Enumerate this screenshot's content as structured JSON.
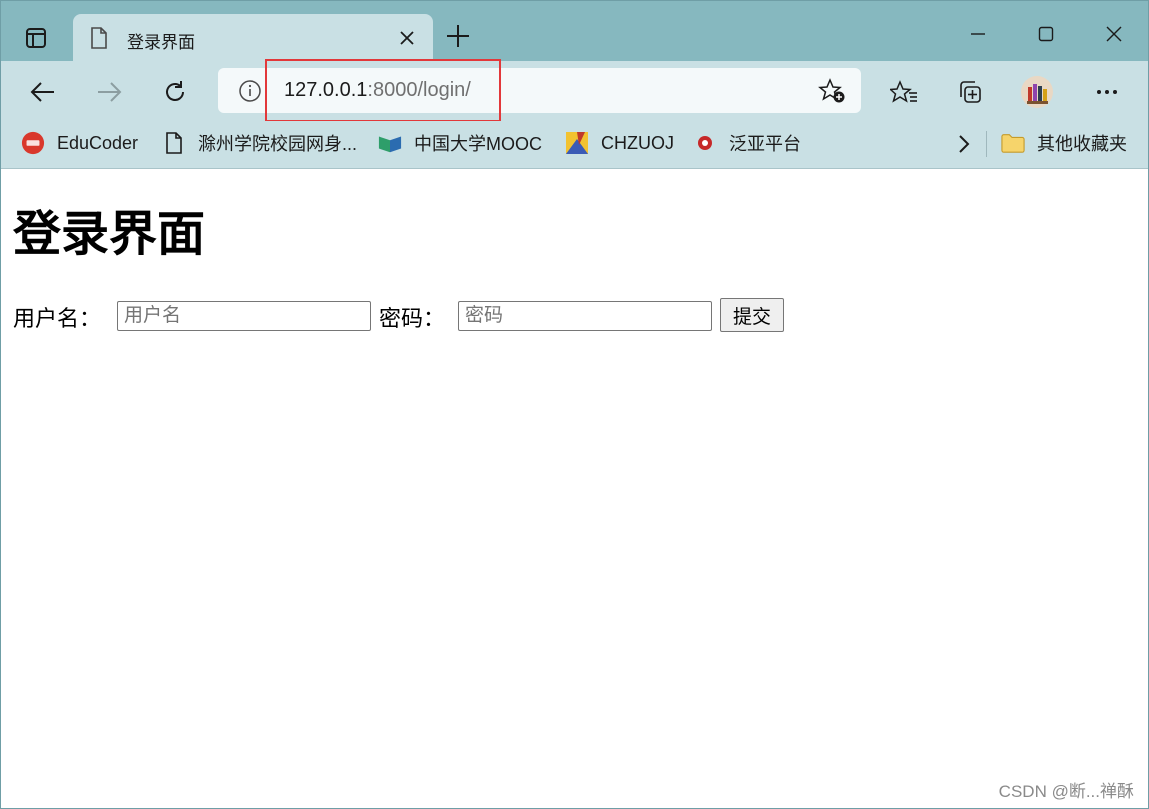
{
  "window": {
    "tab_title": "登录界面",
    "controls": {
      "minimize": "minimize",
      "maximize": "maximize",
      "close": "close"
    }
  },
  "addressbar": {
    "url_host": "127.0.0.1",
    "url_rest": ":8000/login/"
  },
  "bookmarks": [
    {
      "label": "EduCoder",
      "icon": "toutiao-icon"
    },
    {
      "label": "滁州学院校园网身...",
      "icon": "page-icon"
    },
    {
      "label": "中国大学MOOC",
      "icon": "mooc-icon"
    },
    {
      "label": "CHZUOJ",
      "icon": "chzuoj-icon"
    },
    {
      "label": "泛亚平台",
      "icon": "fanya-icon"
    }
  ],
  "other_bookmarks": "其他收藏夹",
  "page": {
    "heading": "登录界面",
    "username_label": "用户名：",
    "username_placeholder": "用户名",
    "username_value": "",
    "password_label": "密码：",
    "password_placeholder": "密码",
    "password_value": "",
    "submit_label": "提交"
  },
  "watermark": "CSDN @断...禅酥",
  "colors": {
    "titlebar": "#86b8bf",
    "toolbar": "#c9e0e4",
    "highlight": "#e2383a"
  }
}
